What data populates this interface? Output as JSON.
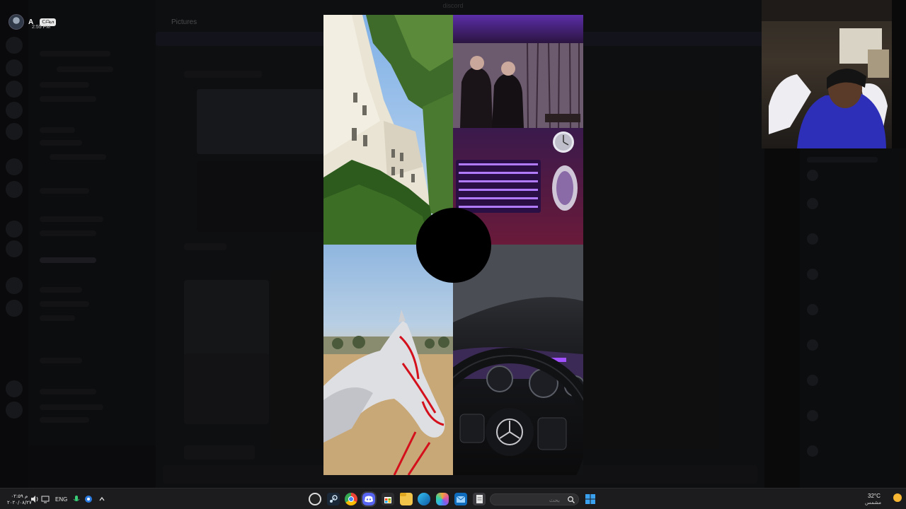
{
  "window": {
    "title": "discord"
  },
  "user": {
    "name": "A",
    "badge": "ᑕᗩᔕ",
    "time": "2:55 PM"
  },
  "channel": {
    "title": "Pictures"
  },
  "collage": {
    "tiles": [
      {
        "label": "building-photo"
      },
      {
        "label": "purple-gaming-photo"
      },
      {
        "label": "horse-photo"
      },
      {
        "label": "car-steering-wheel-photo"
      }
    ]
  },
  "taskbar": {
    "time": "۰۲:۵۹ م",
    "date": "۲۰۲۰/۰۸/۲۷",
    "language": "ENG",
    "search_placeholder": "بحث",
    "weather_temp": "32°C",
    "weather_label": "مشمس",
    "apps": [
      "steam",
      "chrome",
      "discord",
      "store",
      "file-explorer",
      "edge",
      "copilot",
      "outlook",
      "notepad"
    ]
  }
}
